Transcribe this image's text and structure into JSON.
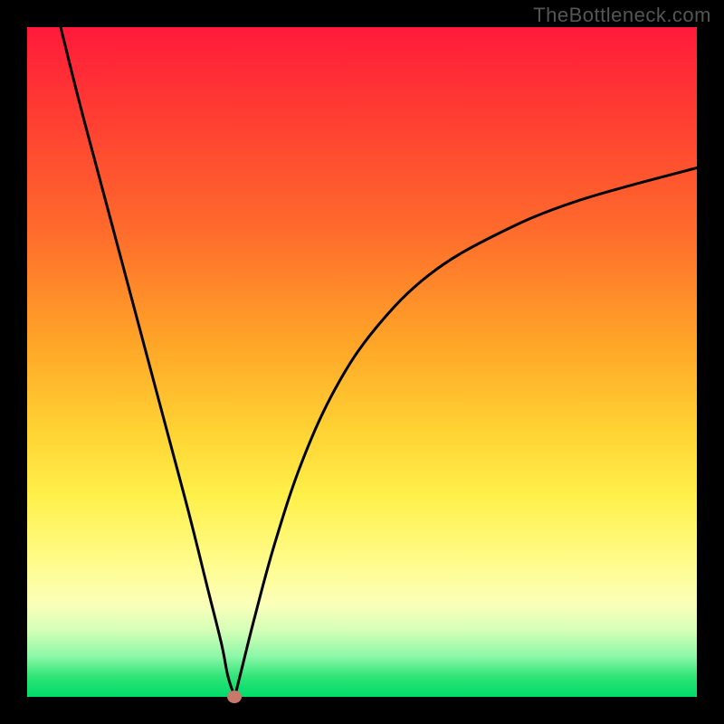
{
  "watermark": "TheBottleneck.com",
  "colors": {
    "frame": "#000000",
    "top": "#ff1a3a",
    "bottom": "#00db6a",
    "curve_stroke": "#000000",
    "dot": "#c77a6b"
  },
  "chart_data": {
    "type": "line",
    "title": "",
    "xlabel": "",
    "ylabel": "",
    "xlim": [
      0,
      100
    ],
    "ylim": [
      0,
      100
    ],
    "grid": false,
    "legend": false,
    "annotations": [],
    "marker": {
      "x": 31,
      "y": 0,
      "color": "#c77a6b"
    },
    "series": [
      {
        "name": "left-branch",
        "x": [
          5,
          8,
          12,
          16,
          20,
          24,
          27,
          29,
          30,
          31
        ],
        "y": [
          100,
          88,
          73,
          58,
          43,
          28,
          16,
          8,
          3,
          0
        ]
      },
      {
        "name": "right-branch",
        "x": [
          31,
          32,
          34,
          37,
          41,
          46,
          52,
          60,
          70,
          82,
          100
        ],
        "y": [
          0,
          4,
          12,
          23,
          35,
          46,
          55,
          63,
          69,
          74,
          79
        ]
      }
    ]
  }
}
